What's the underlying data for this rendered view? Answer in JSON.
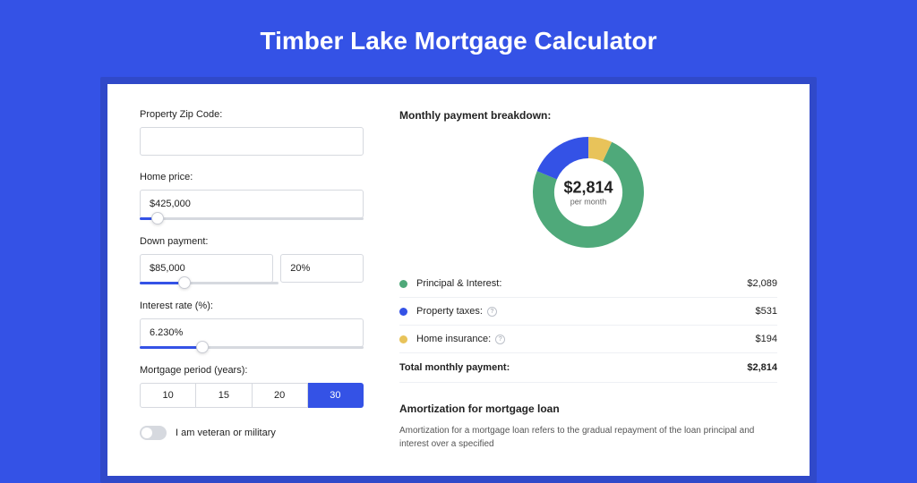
{
  "title": "Timber Lake Mortgage Calculator",
  "form": {
    "zip": {
      "label": "Property Zip Code:",
      "value": ""
    },
    "home_price": {
      "label": "Home price:",
      "value": "$425,000",
      "slider_pct": 8
    },
    "down_payment": {
      "label": "Down payment:",
      "amount": "$85,000",
      "pct": "20%",
      "slider_pct": 20
    },
    "interest": {
      "label": "Interest rate (%):",
      "value": "6.230%",
      "slider_pct": 28
    },
    "period": {
      "label": "Mortgage period (years):",
      "options": [
        "10",
        "15",
        "20",
        "30"
      ],
      "selected": "30"
    },
    "veteran": {
      "label": "I am veteran or military",
      "on": false
    }
  },
  "breakdown": {
    "title": "Monthly payment breakdown:",
    "center_amount": "$2,814",
    "center_sub": "per month",
    "items": [
      {
        "label": "Principal & Interest:",
        "value": "$2,089",
        "color": "green",
        "info": false
      },
      {
        "label": "Property taxes:",
        "value": "$531",
        "color": "blue",
        "info": true
      },
      {
        "label": "Home insurance:",
        "value": "$194",
        "color": "yellow",
        "info": true
      }
    ],
    "total_label": "Total monthly payment:",
    "total_value": "$2,814"
  },
  "amort": {
    "title": "Amortization for mortgage loan",
    "text": "Amortization for a mortgage loan refers to the gradual repayment of the loan principal and interest over a specified"
  },
  "chart_data": {
    "type": "pie",
    "title": "Monthly payment breakdown",
    "series": [
      {
        "name": "Principal & Interest",
        "value": 2089,
        "color": "#4fa97a"
      },
      {
        "name": "Property taxes",
        "value": 531,
        "color": "#3452e6"
      },
      {
        "name": "Home insurance",
        "value": 194,
        "color": "#e8c35a"
      }
    ],
    "total": 2814,
    "center_label": "$2,814 per month"
  }
}
